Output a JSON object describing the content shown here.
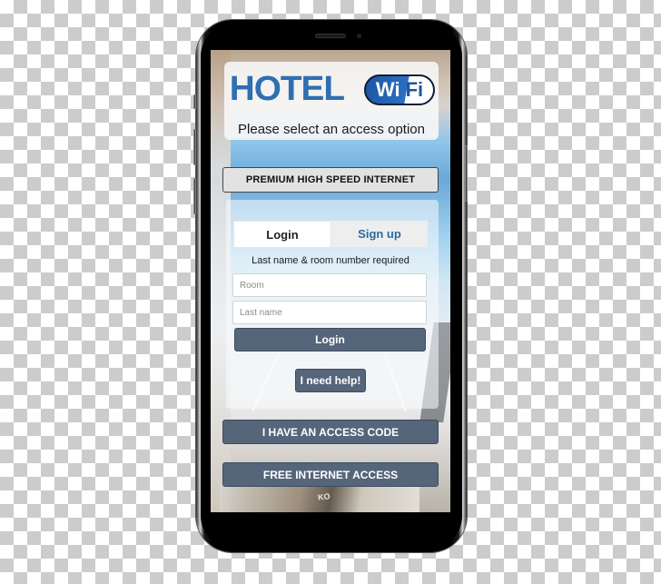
{
  "app": {
    "brand_word": "HOTEL",
    "wifi_badge": {
      "wi": "Wi",
      "fi": "Fi"
    },
    "subtitle": "Please select an access option"
  },
  "options": {
    "premium_label": "PREMIUM HIGH SPEED INTERNET",
    "access_code_label": "I HAVE AN ACCESS CODE",
    "free_label": "FREE INTERNET ACCESS"
  },
  "login_panel": {
    "tabs": [
      {
        "label": "Login",
        "active": true
      },
      {
        "label": "Sign up",
        "active": false
      }
    ],
    "requirement_text": "Last name & room number required",
    "room_field": {
      "value": "",
      "placeholder": "Room"
    },
    "lastname_field": {
      "value": "",
      "placeholder": "Last name"
    },
    "login_button_label": "Login",
    "help_button_label": "I need help!"
  },
  "background": {
    "book_label": "KO"
  },
  "colors": {
    "brand_blue": "#2f6fb1",
    "button_dark": "#55657a",
    "signup_tab_text": "#2a6aa0"
  }
}
